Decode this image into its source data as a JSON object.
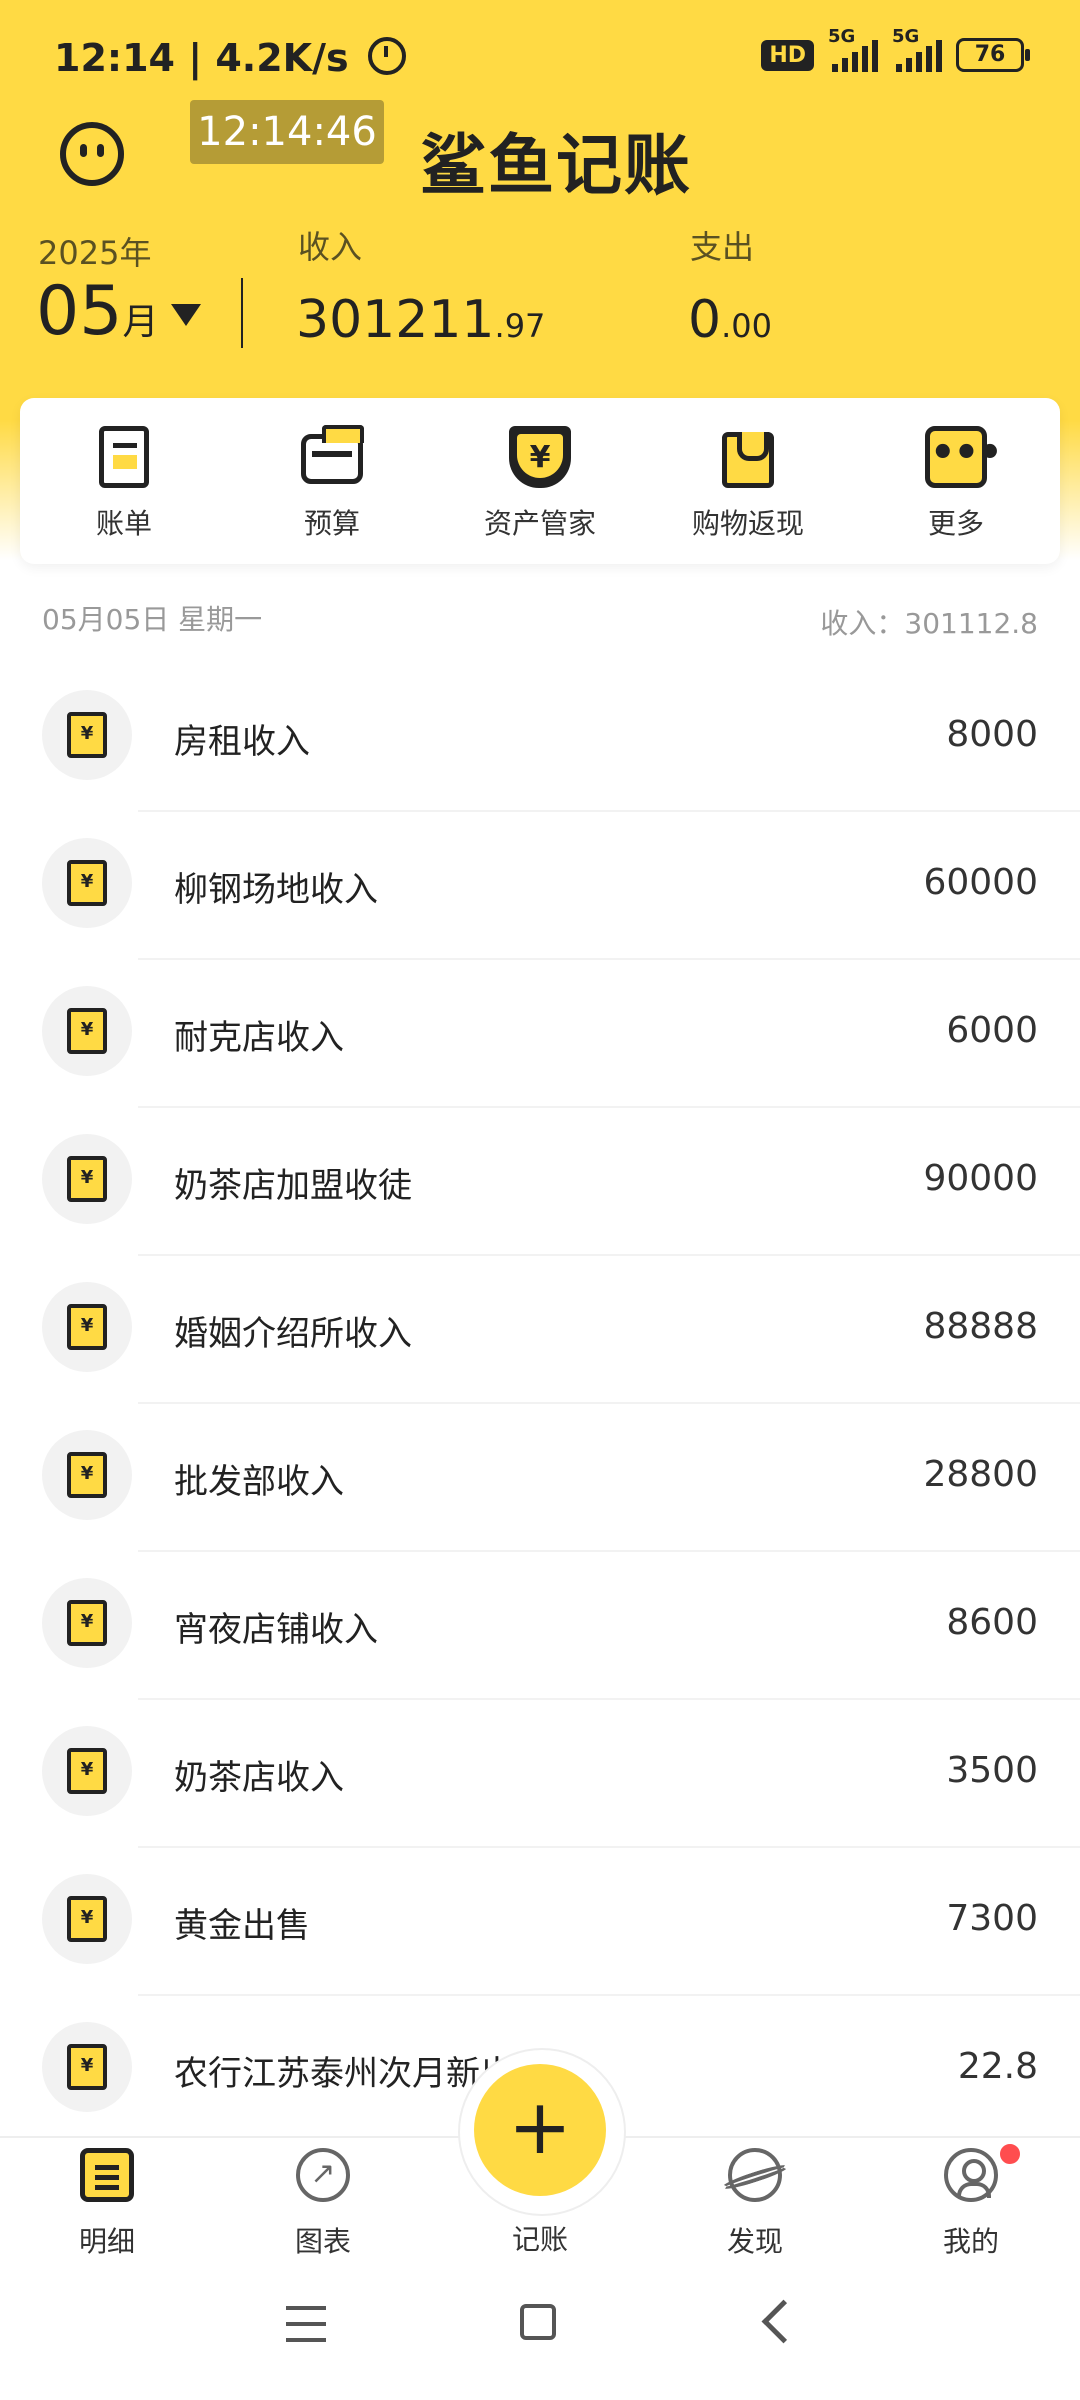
{
  "status_bar": {
    "time": "12:14",
    "net_speed": "4.2K/s",
    "hd_badge": "HD",
    "signal_1": "5G",
    "signal_2": "5G",
    "battery": "76"
  },
  "header": {
    "clock_overlay": "12:14:46",
    "app_title": "鲨鱼记账",
    "year": "2025年",
    "month": "05",
    "month_unit": "月",
    "income_label": "收入",
    "income_int": "301211",
    "income_dec": ".97",
    "expense_label": "支出",
    "expense_int": "0",
    "expense_dec": ".00"
  },
  "quick_menu": [
    {
      "label": "账单",
      "icon": "bill-icon"
    },
    {
      "label": "预算",
      "icon": "budget-wallet-icon"
    },
    {
      "label": "资产管家",
      "icon": "asset-shield-icon"
    },
    {
      "label": "购物返现",
      "icon": "shopping-bag-icon"
    },
    {
      "label": "更多",
      "icon": "more-icon"
    }
  ],
  "day_group": {
    "date": "05月05日 星期一",
    "summary": "收入：301112.8"
  },
  "transactions": [
    {
      "name": "房租收入",
      "amount": "8000"
    },
    {
      "name": "柳钢场地收入",
      "amount": "60000"
    },
    {
      "name": "耐克店收入",
      "amount": "6000"
    },
    {
      "name": "奶茶店加盟收徒",
      "amount": "90000"
    },
    {
      "name": "婚姻介绍所收入",
      "amount": "88888"
    },
    {
      "name": "批发部收入",
      "amount": "28800"
    },
    {
      "name": "宵夜店铺收入",
      "amount": "8600"
    },
    {
      "name": "奶茶店收入",
      "amount": "3500"
    },
    {
      "name": "黄金出售",
      "amount": "7300"
    },
    {
      "name": "农行江苏泰州次月新出力",
      "amount": "22.8"
    }
  ],
  "receipt_glyph": "¥",
  "bottom_nav": {
    "detail": "明细",
    "chart": "图表",
    "add": "记账",
    "add_glyph": "+",
    "discover": "发现",
    "mine": "我的"
  },
  "colors": {
    "brand_yellow": "#FFDA44",
    "text_dark": "#222222",
    "badge_red": "#ff4d4f"
  }
}
